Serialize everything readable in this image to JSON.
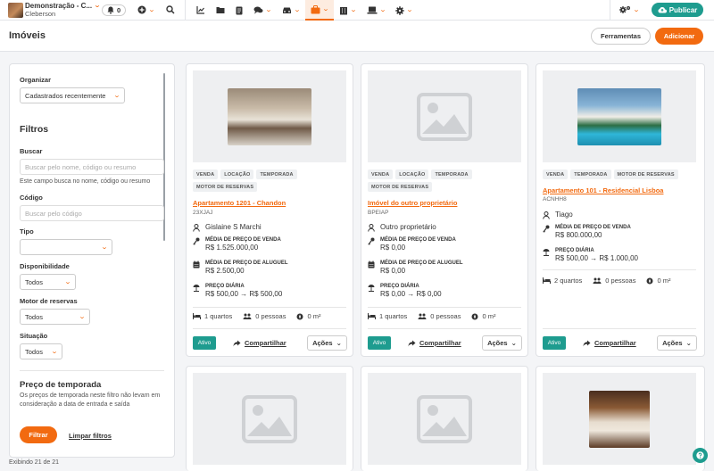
{
  "topbar": {
    "company_name": "Demonstração - C...",
    "user_name": "Cleberson",
    "notifications_count": "0",
    "publish_label": "Publicar",
    "nav_icons": [
      "chart-icon",
      "folder-icon",
      "document-icon",
      "chat-icon",
      "car-icon",
      "briefcase-icon",
      "building-icon",
      "laptop-icon",
      "gear-icon"
    ]
  },
  "header": {
    "title": "Imóveis",
    "tools_label": "Ferramentas",
    "add_label": "Adicionar"
  },
  "filters": {
    "organize_label": "Organizar",
    "organize_value": "Cadastrados recentemente",
    "heading": "Filtros",
    "search_label": "Buscar",
    "search_placeholder": "Buscar pelo nome, código ou resumo",
    "search_help": "Este campo busca no nome, código ou resumo",
    "code_label": "Código",
    "code_placeholder": "Buscar pelo código",
    "type_label": "Tipo",
    "type_value": "",
    "availability_label": "Disponibilidade",
    "availability_value": "Todos",
    "booking_label": "Motor de reservas",
    "booking_value": "Todos",
    "situation_label": "Situação",
    "situation_value": "Todos",
    "season_heading": "Preço de temporada",
    "season_help": "Os preços de temporada neste filtro não levam em consideração a data de entrada e saída",
    "filter_button": "Filtrar",
    "clear_button": "Limpar filtros"
  },
  "footer": {
    "count_text": "Exibindo 21 de 21"
  },
  "cards": [
    {
      "photo": "living-room",
      "tags": [
        "VENDA",
        "LOCAÇÃO",
        "TEMPORADA",
        "MOTOR DE RESERVAS"
      ],
      "title": "Apartamento 1201 - Chandon",
      "code": "23XJAJ",
      "owner": "Gislaine S Marchi",
      "sale_label": "MÉDIA DE PREÇO DE VENDA",
      "sale_value": "R$ 1.525.000,00",
      "rent_label": "MÉDIA DE PREÇO DE ALUGUEL",
      "rent_value": "R$ 2.500,00",
      "daily_label": "PREÇO DIÁRIA",
      "daily_from": "R$ 500,00",
      "daily_to": "R$ 500,00",
      "rooms": "1 quartos",
      "people": "0 pessoas",
      "area": "0 m²",
      "status": "Ativo",
      "share": "Compartilhar",
      "actions": "Ações"
    },
    {
      "photo": "placeholder",
      "tags": [
        "VENDA",
        "LOCAÇÃO",
        "TEMPORADA",
        "MOTOR DE RESERVAS"
      ],
      "title": "Imóvel do outro proprietário",
      "code": "BPEIAP",
      "owner": "Outro proprietário",
      "sale_label": "MÉDIA DE PREÇO DE VENDA",
      "sale_value": "R$ 0,00",
      "rent_label": "MÉDIA DE PREÇO DE ALUGUEL",
      "rent_value": "R$ 0,00",
      "daily_label": "PREÇO DIÁRIA",
      "daily_from": "R$ 0,00",
      "daily_to": "R$ 0,00",
      "rooms": "1 quartos",
      "people": "0 pessoas",
      "area": "0 m²",
      "status": "Ativo",
      "share": "Compartilhar",
      "actions": "Ações"
    },
    {
      "photo": "pool-house",
      "tags": [
        "VENDA",
        "TEMPORADA",
        "MOTOR DE RESERVAS"
      ],
      "title": "Apartamento 101 - Residencial Lisboa",
      "code": "ACNHH8",
      "owner": "Tiago",
      "sale_label": "MÉDIA DE PREÇO DE VENDA",
      "sale_value": "R$ 800.000,00",
      "daily_label": "PREÇO DIÁRIA",
      "daily_from": "R$ 500,00",
      "daily_to": "R$ 1.000,00",
      "rooms": "2 quartos",
      "people": "0 pessoas",
      "area": "0 m²",
      "status": "Ativo",
      "share": "Compartilhar",
      "actions": "Ações"
    },
    {
      "photo": "placeholder"
    },
    {
      "photo": "placeholder"
    },
    {
      "photo": "bedroom"
    }
  ]
}
